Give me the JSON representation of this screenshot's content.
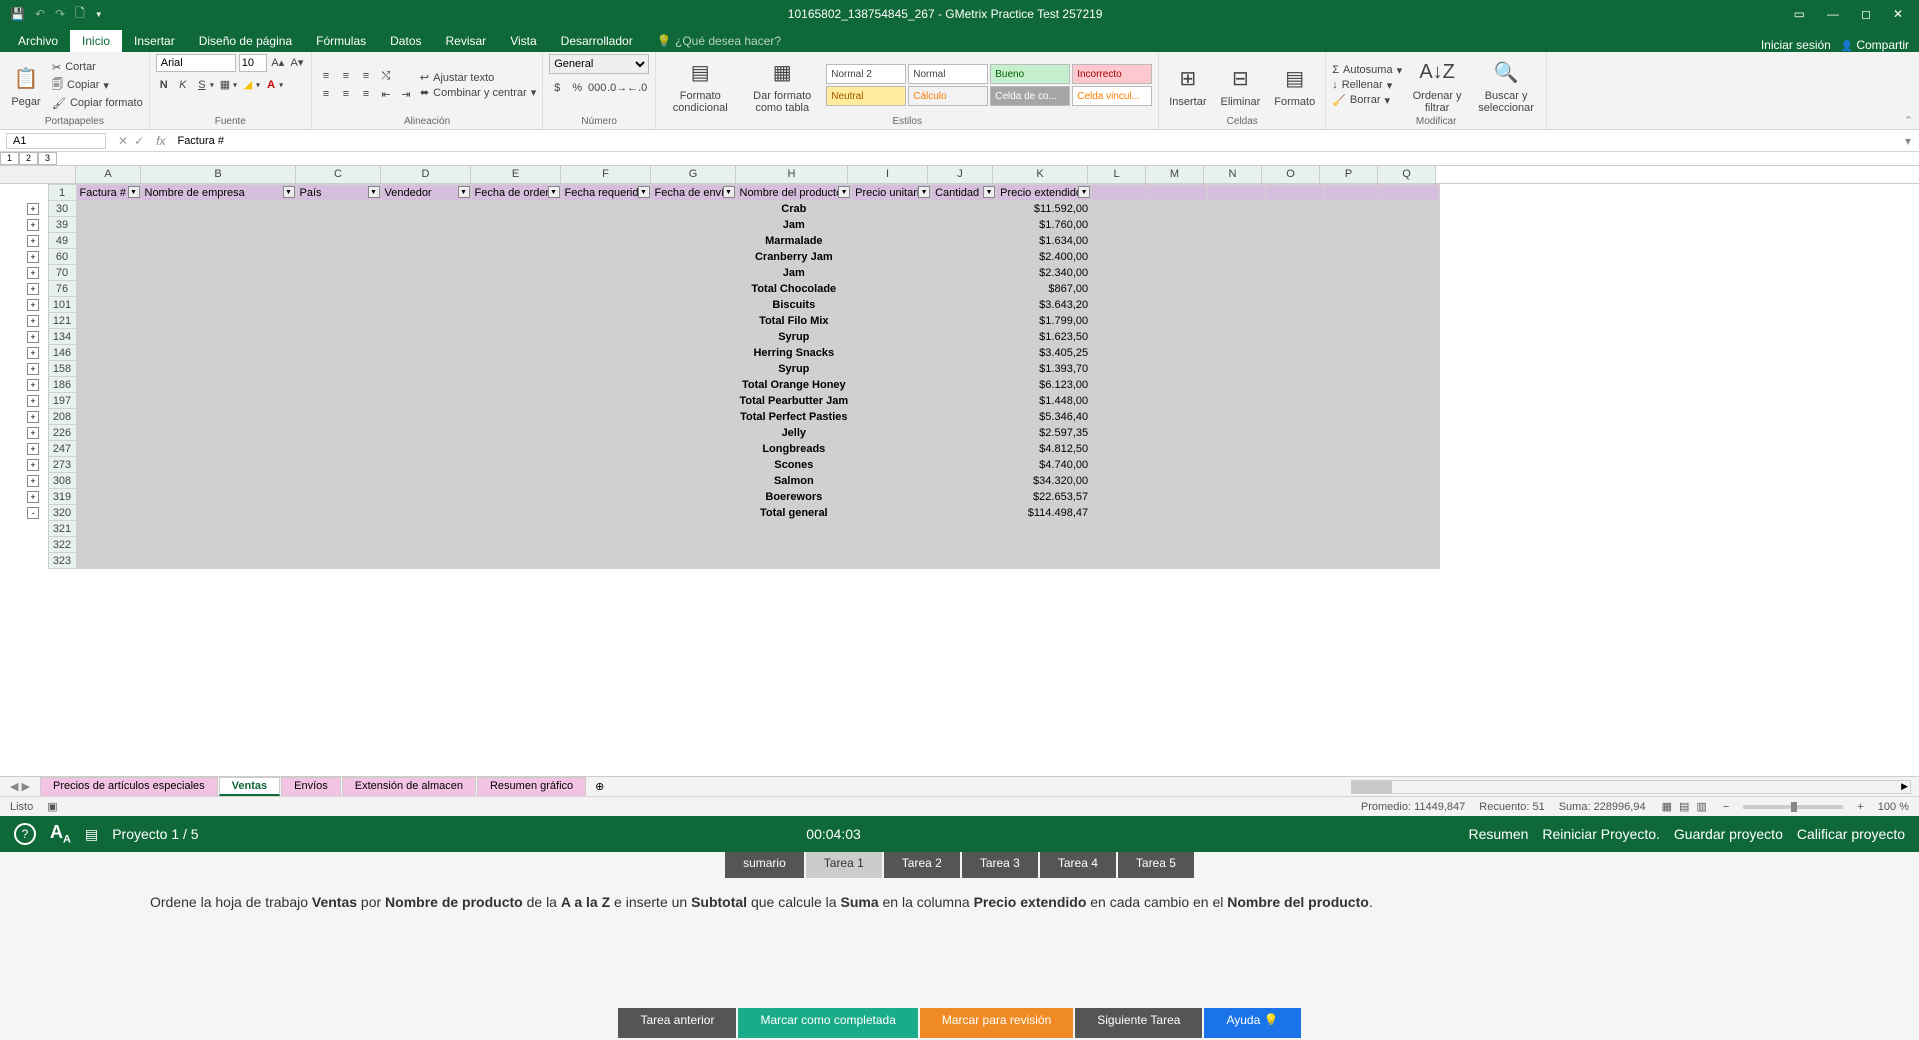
{
  "title_bar": {
    "doc_title": "10165802_138754845_267 - GMetrix Practice Test 257219"
  },
  "tabs": {
    "items": [
      "Archivo",
      "Inicio",
      "Insertar",
      "Diseño de página",
      "Fórmulas",
      "Datos",
      "Revisar",
      "Vista",
      "Desarrollador"
    ],
    "active": "Inicio",
    "tell_me": "¿Qué desea hacer?",
    "sign_in": "Iniciar sesión",
    "share": "Compartir"
  },
  "ribbon": {
    "clipboard": {
      "paste": "Pegar",
      "cut": "Cortar",
      "copy": "Copiar",
      "format_painter": "Copiar formato",
      "label": "Portapapeles"
    },
    "font": {
      "name": "Arial",
      "size": "10",
      "label": "Fuente"
    },
    "alignment": {
      "wrap": "Ajustar texto",
      "merge": "Combinar y centrar",
      "label": "Alineación"
    },
    "number": {
      "format": "General",
      "label": "Número"
    },
    "styles": {
      "cond": "Formato condicional",
      "table": "Dar formato como tabla",
      "s0": "Normal 2",
      "s1": "Normal",
      "s2": "Bueno",
      "s3": "Incorrecto",
      "s4": "Neutral",
      "s5": "Cálculo",
      "s6": "Celda de co...",
      "s7": "Celda vincul...",
      "label": "Estilos"
    },
    "cells": {
      "insert": "Insertar",
      "delete": "Eliminar",
      "format": "Formato",
      "label": "Celdas"
    },
    "editing": {
      "autosum": "Autosuma",
      "fill": "Rellenar",
      "clear": "Borrar",
      "sort": "Ordenar y filtrar",
      "find": "Buscar y seleccionar",
      "label": "Modificar"
    }
  },
  "name_box": "A1",
  "formula": "Factura #",
  "columns": [
    "A",
    "B",
    "C",
    "D",
    "E",
    "F",
    "G",
    "H",
    "I",
    "J",
    "K",
    "L",
    "M",
    "N",
    "O",
    "P",
    "Q"
  ],
  "headers": [
    "Factura #",
    "Nombre de empresa",
    "País",
    "Vendedor",
    "Fecha de orden",
    "Fecha requerida",
    "Fecha de envío",
    "Nombre del producto",
    "Precio unitario",
    "Cantidad",
    "Precio extendido"
  ],
  "rows": [
    {
      "r": "30",
      "p": "Crab",
      "v": "$11.592,00",
      "g": "+"
    },
    {
      "r": "39",
      "p": "Jam",
      "v": "$1.760,00",
      "g": "+"
    },
    {
      "r": "49",
      "p": "Marmalade",
      "v": "$1.634,00",
      "g": "+"
    },
    {
      "r": "60",
      "p": "Cranberry Jam",
      "v": "$2.400,00",
      "g": "+"
    },
    {
      "r": "70",
      "p": "Jam",
      "v": "$2.340,00",
      "g": "+"
    },
    {
      "r": "76",
      "p": "Total Chocolade",
      "v": "$867,00",
      "g": "+"
    },
    {
      "r": "101",
      "p": "Biscuits",
      "v": "$3.643,20",
      "g": "+"
    },
    {
      "r": "121",
      "p": "Total Filo Mix",
      "v": "$1.799,00",
      "g": "+"
    },
    {
      "r": "134",
      "p": "Syrup",
      "v": "$1.623,50",
      "g": "+"
    },
    {
      "r": "146",
      "p": "Herring Snacks",
      "v": "$3.405,25",
      "g": "+"
    },
    {
      "r": "158",
      "p": "Syrup",
      "v": "$1.393,70",
      "g": "+"
    },
    {
      "r": "186",
      "p": "Total Orange Honey",
      "v": "$6.123,00",
      "g": "+"
    },
    {
      "r": "197",
      "p": "Total Pearbutter Jam",
      "v": "$1.448,00",
      "g": "+"
    },
    {
      "r": "208",
      "p": "Total Perfect Pasties",
      "v": "$5.346,40",
      "g": "+"
    },
    {
      "r": "226",
      "p": "Jelly",
      "v": "$2.597,35",
      "g": "+"
    },
    {
      "r": "247",
      "p": "Longbreads",
      "v": "$4.812,50",
      "g": "+"
    },
    {
      "r": "273",
      "p": "Scones",
      "v": "$4.740,00",
      "g": "+"
    },
    {
      "r": "308",
      "p": "Salmon",
      "v": "$34.320,00",
      "g": "+"
    },
    {
      "r": "319",
      "p": "Boerewors",
      "v": "$22.653,57",
      "g": "+"
    },
    {
      "r": "320",
      "p": "Total general",
      "v": "$114.498,47",
      "g": "-"
    }
  ],
  "empty_rows": [
    "321",
    "322",
    "323"
  ],
  "sheets": {
    "items": [
      "Precios de artículos especiales",
      "Ventas",
      "Envíos",
      "Extensión de almacen",
      "Resumen gráfico"
    ],
    "active": "Ventas"
  },
  "status": {
    "ready": "Listo",
    "avg": "Promedio: 11449,847",
    "count": "Recuento: 51",
    "sum": "Suma: 228996,94",
    "zoom": "100 %"
  },
  "gmetrix": {
    "project": "Proyecto 1 / 5",
    "timer": "00:04:03",
    "summary": "Resumen",
    "restart": "Reiniciar Proyecto.",
    "save": "Guardar proyecto",
    "grade": "Calificar proyecto"
  },
  "task_tabs": {
    "items": [
      "sumario",
      "Tarea 1",
      "Tarea 2",
      "Tarea 3",
      "Tarea 4",
      "Tarea 5"
    ],
    "active": "Tarea 1"
  },
  "task": {
    "t0": "Ordene la hoja de trabajo ",
    "b1": "Ventas",
    "t1": " por ",
    "b2": "Nombre de producto",
    "t2": " de la ",
    "b3": "A a la Z",
    "t3": " e inserte un ",
    "b4": "Subtotal",
    "t4": " que calcule la ",
    "b5": "Suma",
    "t5": " en la columna ",
    "b6": "Precio extendido",
    "t6": " en cada cambio en el ",
    "b7": "Nombre del producto",
    "t7": "."
  },
  "bottom": {
    "prev": "Tarea anterior",
    "complete": "Marcar como completada",
    "review": "Marcar para revisión",
    "next": "Siguiente Tarea",
    "help": "Ayuda"
  }
}
